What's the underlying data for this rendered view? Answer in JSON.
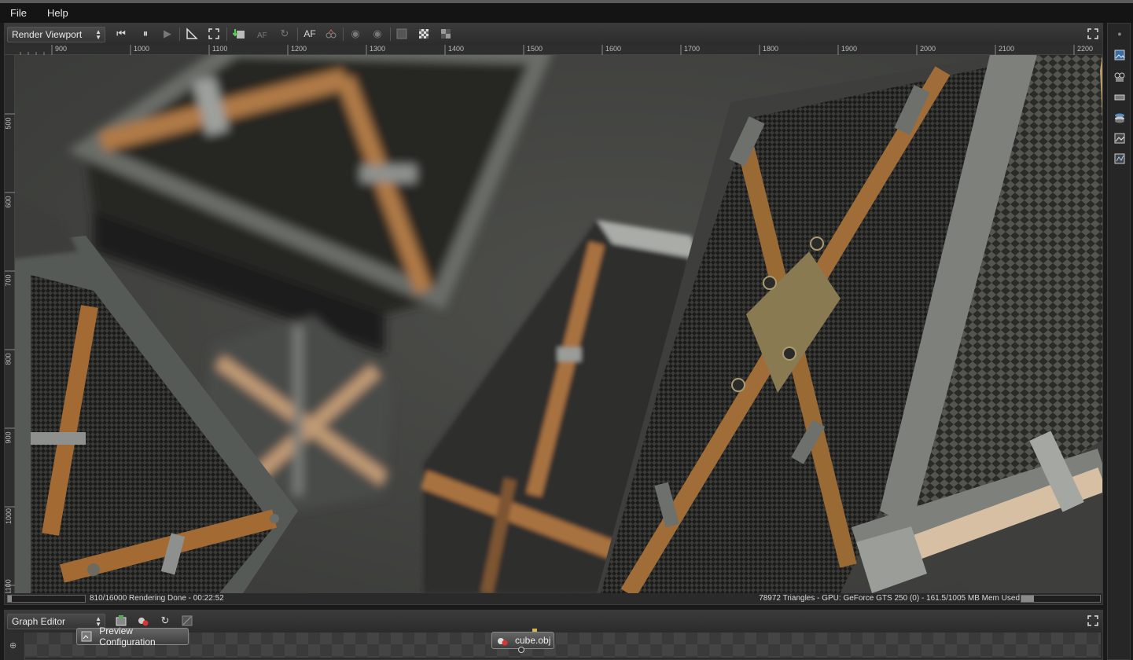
{
  "menubar": {
    "items": [
      "File",
      "Help"
    ]
  },
  "viewport_panel": {
    "selector_label": "Render Viewport",
    "toolbar_text_button": "AF",
    "ruler_top_labels": [
      "900",
      "1000",
      "1100",
      "1200",
      "1300",
      "1400",
      "1500",
      "1600",
      "1700",
      "1800",
      "1900",
      "2000",
      "2100",
      "2200"
    ],
    "ruler_left_labels": [
      "500",
      "600",
      "700",
      "800",
      "900",
      "1000",
      "1100"
    ],
    "status_left": "810/16000 Rendering Done - 00:22:52",
    "status_right": "78972 Triangles - GPU: GeForce GTS 250 (0) - 161.5/1005 MB Mem Used",
    "render_progress": 0.05,
    "memory_usage": 0.16
  },
  "graph_editor": {
    "selector_label": "Graph Editor",
    "nodes": {
      "preview": "Preview Configuration",
      "mesh": "cube.obj"
    }
  },
  "colors": {
    "accent_wood": "#b07a46",
    "panel_bg": "#2b2b2b",
    "viewport_bg": "#4b4c48"
  }
}
